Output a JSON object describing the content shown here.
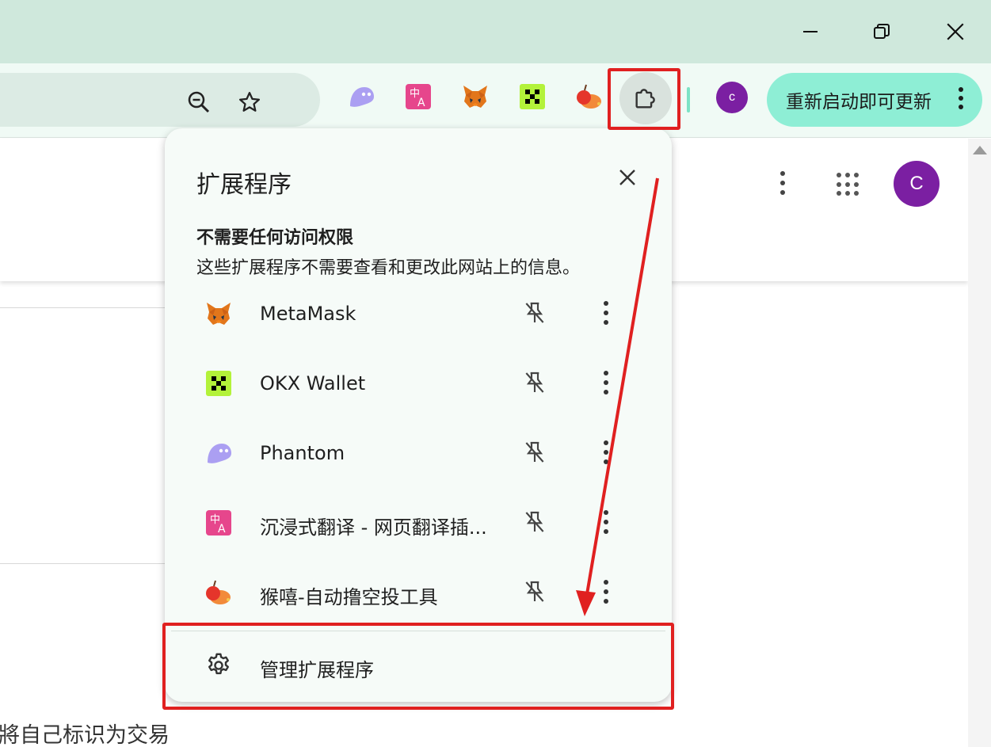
{
  "window": {
    "minimize_icon": "minimize-icon",
    "restore_icon": "restore-icon",
    "close_icon": "close-icon"
  },
  "toolbar": {
    "zoom_icon": "zoom-out-icon",
    "bookmark_icon": "star-icon",
    "pinned_extensions": [
      "phantom-icon",
      "immersive-translate-icon",
      "metamask-icon",
      "okx-wallet-icon",
      "houxi-icon"
    ],
    "extensions_button_icon": "puzzle-icon",
    "profile_initial": "c",
    "update_label": "重新启动即可更新"
  },
  "page": {
    "profile_initial": "C",
    "bottom_text": "將自己标识为交易"
  },
  "popup": {
    "title": "扩展程序",
    "section_title": "不需要任何访问权限",
    "section_desc": "这些扩展程序不需要查看和更改此网站上的信息。",
    "items": [
      {
        "name": "MetaMask",
        "icon": "metamask-icon"
      },
      {
        "name": "OKX Wallet",
        "icon": "okx-wallet-icon"
      },
      {
        "name": "Phantom",
        "icon": "phantom-icon"
      },
      {
        "name": "沉浸式翻译 - 网页翻译插...",
        "icon": "immersive-translate-icon"
      },
      {
        "name": "猴嘻-自动撸空投工具",
        "icon": "houxi-icon"
      }
    ],
    "manage_label": "管理扩展程序"
  },
  "colors": {
    "titlebar": "#cfe8dc",
    "toolbar": "#f0faf5",
    "update_button": "#8eeed5",
    "profile": "#7b1fa2",
    "annotation": "#e02020"
  }
}
